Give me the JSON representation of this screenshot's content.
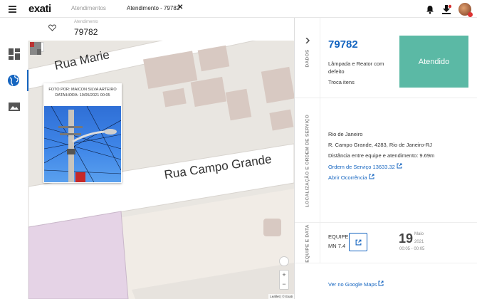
{
  "app": {
    "logo": "exati"
  },
  "tabs": [
    {
      "label": "Atendimentos"
    },
    {
      "label": "Atendimento - 79782"
    }
  ],
  "subheader": {
    "label": "Atendimento",
    "number": "79782"
  },
  "map": {
    "streets": [
      "Rua Marie",
      "Rua Campo Grande"
    ],
    "attribution": "Leaflet | © Exati",
    "popup": {
      "line1": "FOTO POR: MAICON SILVA ARTEIRO",
      "line2": "DATA/HORA: 19/05/2021 00:05"
    }
  },
  "panel": {
    "dados": {
      "label": "DADOS",
      "number": "79782",
      "description": "Lâmpada e Reator com defeito",
      "action": "Troca itens",
      "status": "Atendido",
      "status_color": "#5bb9a5"
    },
    "localizacao": {
      "label": "LOCALIZAÇÃO E ORDEM DE SERVIÇO",
      "city": "Rio de Janeiro",
      "address": "R. Campo Grande, 4283, Rio de Janeiro-RJ",
      "distance": "Distância entre equipe e atendimento: 9.69m",
      "order_link": "Ordem de Serviço 13633.32",
      "occurrence_link": "Abrir Ocorrência"
    },
    "equipe": {
      "label": "EQUIPE E DATA",
      "team_label": "EQUIPE",
      "team_value": "MN 7.4",
      "day": "19",
      "month": "Maio",
      "year": "2021",
      "time": "00:05 - 00:05"
    },
    "google_maps": "Ver no Google Maps"
  },
  "colors": {
    "accent": "#1565c0",
    "status": "#5bb9a5"
  }
}
